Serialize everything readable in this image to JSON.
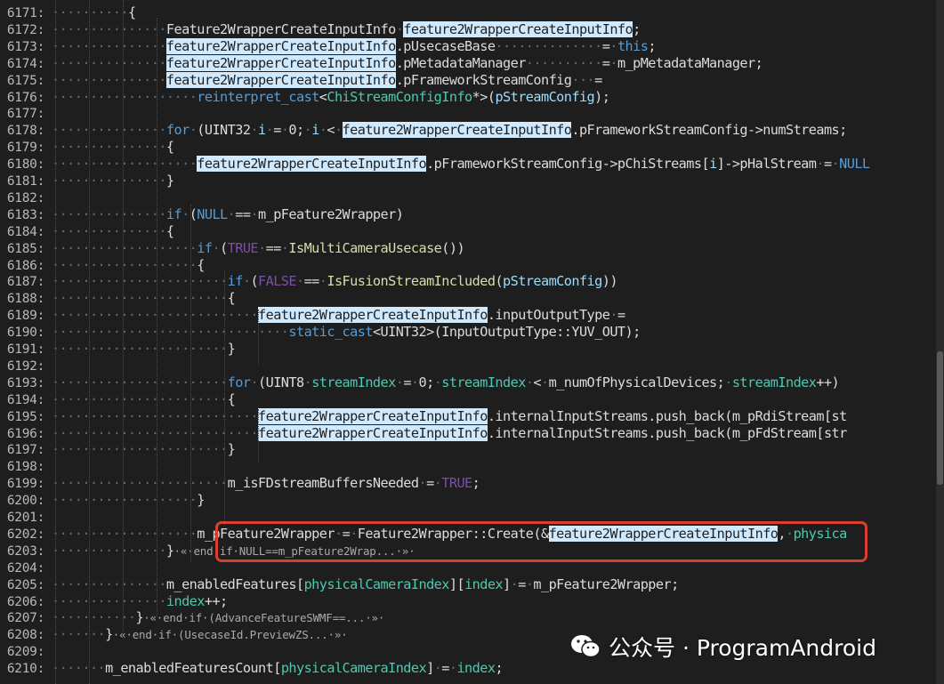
{
  "editor": {
    "lines": [
      {
        "n": "6171:",
        "t": [
          [
            "ws",
            "··········"
          ],
          [
            "p",
            "{"
          ]
        ]
      },
      {
        "n": "6172:",
        "t": [
          [
            "ws",
            "···············"
          ],
          [
            "p",
            "Feature2WrapperCreateInputInfo"
          ],
          [
            "ws",
            "·"
          ],
          [
            "hl",
            "feature2WrapperCreateInputInfo"
          ],
          [
            "p",
            ";"
          ]
        ]
      },
      {
        "n": "6173:",
        "t": [
          [
            "ws",
            "···············"
          ],
          [
            "hl",
            "feature2WrapperCreateInputInfo"
          ],
          [
            "p",
            ".pUsecaseBase"
          ],
          [
            "ws",
            "··············"
          ],
          [
            "p",
            "="
          ],
          [
            "ws",
            "·"
          ],
          [
            "kw",
            "this"
          ],
          [
            "p",
            ";"
          ]
        ]
      },
      {
        "n": "6174:",
        "t": [
          [
            "ws",
            "···············"
          ],
          [
            "hl",
            "feature2WrapperCreateInputInfo"
          ],
          [
            "p",
            ".pMetadataManager"
          ],
          [
            "ws",
            "··········"
          ],
          [
            "p",
            "="
          ],
          [
            "ws",
            "·"
          ],
          [
            "p",
            "m_pMetadataManager;"
          ]
        ]
      },
      {
        "n": "6175:",
        "t": [
          [
            "ws",
            "···············"
          ],
          [
            "hl",
            "feature2WrapperCreateInputInfo"
          ],
          [
            "p",
            ".pFrameworkStreamConfig"
          ],
          [
            "ws",
            "···"
          ],
          [
            "p",
            "="
          ]
        ]
      },
      {
        "n": "6176:",
        "t": [
          [
            "ws",
            "···················"
          ],
          [
            "kw",
            "reinterpret_cast"
          ],
          [
            "p",
            "<"
          ],
          [
            "ty",
            "ChiStreamConfigInfo"
          ],
          [
            "p",
            "*>("
          ],
          [
            "pa",
            "pStreamConfig"
          ],
          [
            "p",
            ");"
          ]
        ]
      },
      {
        "n": "6177:",
        "t": []
      },
      {
        "n": "6178:",
        "t": [
          [
            "ws",
            "···············"
          ],
          [
            "kw",
            "for"
          ],
          [
            "ws",
            "·"
          ],
          [
            "p",
            "(UINT32"
          ],
          [
            "ws",
            "·"
          ],
          [
            "pa",
            "i"
          ],
          [
            "ws",
            "·"
          ],
          [
            "p",
            "="
          ],
          [
            "ws",
            "·"
          ],
          [
            "p",
            "0;"
          ],
          [
            "ws",
            "·"
          ],
          [
            "pa",
            "i"
          ],
          [
            "ws",
            "·"
          ],
          [
            "p",
            "<"
          ],
          [
            "ws",
            "·"
          ],
          [
            "hl",
            "feature2WrapperCreateInputInfo"
          ],
          [
            "p",
            ".pFrameworkStreamConfig->numStreams;"
          ]
        ]
      },
      {
        "n": "6179:",
        "t": [
          [
            "ws",
            "···············"
          ],
          [
            "p",
            "{"
          ]
        ]
      },
      {
        "n": "6180:",
        "t": [
          [
            "ws",
            "···················"
          ],
          [
            "hl",
            "feature2WrapperCreateInputInfo"
          ],
          [
            "p",
            ".pFrameworkStreamConfig->pChiStreams["
          ],
          [
            "pa",
            "i"
          ],
          [
            "p",
            "]->pHalStream"
          ],
          [
            "ws",
            "·"
          ],
          [
            "p",
            "="
          ],
          [
            "ws",
            "·"
          ],
          [
            "kw",
            "NULL"
          ]
        ]
      },
      {
        "n": "6181:",
        "t": [
          [
            "ws",
            "···············"
          ],
          [
            "p",
            "}"
          ]
        ]
      },
      {
        "n": "6182:",
        "t": []
      },
      {
        "n": "6183:",
        "t": [
          [
            "ws",
            "···············"
          ],
          [
            "kw",
            "if"
          ],
          [
            "ws",
            "·"
          ],
          [
            "p",
            "("
          ],
          [
            "kw",
            "NULL"
          ],
          [
            "ws",
            "·"
          ],
          [
            "p",
            "=="
          ],
          [
            "ws",
            "·"
          ],
          [
            "p",
            "m_pFeature2Wrapper)"
          ]
        ]
      },
      {
        "n": "6184:",
        "t": [
          [
            "ws",
            "···············"
          ],
          [
            "p",
            "{"
          ]
        ]
      },
      {
        "n": "6185:",
        "t": [
          [
            "ws",
            "···················"
          ],
          [
            "kw",
            "if"
          ],
          [
            "ws",
            "·"
          ],
          [
            "p",
            "("
          ],
          [
            "lit",
            "TRUE"
          ],
          [
            "ws",
            "·"
          ],
          [
            "p",
            "=="
          ],
          [
            "ws",
            "·"
          ],
          [
            "fn",
            "IsMultiCameraUsecase"
          ],
          [
            "p",
            "())"
          ]
        ]
      },
      {
        "n": "6186:",
        "t": [
          [
            "ws",
            "···················"
          ],
          [
            "p",
            "{"
          ]
        ]
      },
      {
        "n": "6187:",
        "t": [
          [
            "ws",
            "·······················"
          ],
          [
            "kw",
            "if"
          ],
          [
            "ws",
            "·"
          ],
          [
            "p",
            "("
          ],
          [
            "lit",
            "FALSE"
          ],
          [
            "ws",
            "·"
          ],
          [
            "p",
            "=="
          ],
          [
            "ws",
            "·"
          ],
          [
            "fn",
            "IsFusionStreamIncluded"
          ],
          [
            "p",
            "("
          ],
          [
            "pa",
            "pStreamConfig"
          ],
          [
            "p",
            "))"
          ]
        ]
      },
      {
        "n": "6188:",
        "t": [
          [
            "ws",
            "·······················"
          ],
          [
            "p",
            "{"
          ]
        ]
      },
      {
        "n": "6189:",
        "t": [
          [
            "ws",
            "···························"
          ],
          [
            "hl",
            "feature2WrapperCreateInputInfo"
          ],
          [
            "p",
            ".inputOutputType"
          ],
          [
            "ws",
            "·"
          ],
          [
            "p",
            "="
          ]
        ]
      },
      {
        "n": "6190:",
        "t": [
          [
            "ws",
            "·······························"
          ],
          [
            "kw",
            "static_cast"
          ],
          [
            "p",
            "<UINT32>(InputOutputType::YUV_OUT);"
          ]
        ]
      },
      {
        "n": "6191:",
        "t": [
          [
            "ws",
            "·······················"
          ],
          [
            "p",
            "}"
          ]
        ]
      },
      {
        "n": "6192:",
        "t": []
      },
      {
        "n": "6193:",
        "t": [
          [
            "ws",
            "·······················"
          ],
          [
            "kw",
            "for"
          ],
          [
            "ws",
            "·"
          ],
          [
            "p",
            "(UINT8"
          ],
          [
            "ws",
            "·"
          ],
          [
            "ty",
            "streamIndex"
          ],
          [
            "ws",
            "·"
          ],
          [
            "p",
            "="
          ],
          [
            "ws",
            "·"
          ],
          [
            "p",
            "0;"
          ],
          [
            "ws",
            "·"
          ],
          [
            "ty",
            "streamIndex"
          ],
          [
            "ws",
            "·"
          ],
          [
            "p",
            "<"
          ],
          [
            "ws",
            "·"
          ],
          [
            "p",
            "m_numOfPhysicalDevices;"
          ],
          [
            "ws",
            "·"
          ],
          [
            "ty",
            "streamIndex"
          ],
          [
            "p",
            "++)"
          ]
        ]
      },
      {
        "n": "6194:",
        "t": [
          [
            "ws",
            "·······················"
          ],
          [
            "p",
            "{"
          ]
        ]
      },
      {
        "n": "6195:",
        "t": [
          [
            "ws",
            "···························"
          ],
          [
            "hl",
            "feature2WrapperCreateInputInfo"
          ],
          [
            "p",
            ".internalInputStreams.push_back(m_pRdiStream[st"
          ]
        ]
      },
      {
        "n": "6196:",
        "t": [
          [
            "ws",
            "···························"
          ],
          [
            "hl",
            "feature2WrapperCreateInputInfo"
          ],
          [
            "p",
            ".internalInputStreams.push_back(m_pFdStream[str"
          ]
        ]
      },
      {
        "n": "6197:",
        "t": [
          [
            "ws",
            "·······················"
          ],
          [
            "p",
            "}"
          ]
        ]
      },
      {
        "n": "6198:",
        "t": []
      },
      {
        "n": "6199:",
        "t": [
          [
            "ws",
            "·······················"
          ],
          [
            "p",
            "m_isFDstreamBuffersNeeded"
          ],
          [
            "ws",
            "·"
          ],
          [
            "p",
            "="
          ],
          [
            "ws",
            "·"
          ],
          [
            "lit",
            "TRUE"
          ],
          [
            "p",
            ";"
          ]
        ]
      },
      {
        "n": "6200:",
        "t": [
          [
            "ws",
            "···················"
          ],
          [
            "p",
            "}"
          ]
        ]
      },
      {
        "n": "6201:",
        "t": []
      },
      {
        "n": "6202:",
        "t": [
          [
            "ws",
            "···················"
          ],
          [
            "p",
            "m_pFeature2Wrapper"
          ],
          [
            "ws",
            "·"
          ],
          [
            "p",
            "="
          ],
          [
            "ws",
            "·"
          ],
          [
            "p",
            "Feature2Wrapper::Create(&"
          ],
          [
            "hl",
            "feature2WrapperCreateInputInfo"
          ],
          [
            "p",
            ","
          ],
          [
            "ws",
            "·"
          ],
          [
            "ty",
            "physica"
          ]
        ]
      },
      {
        "n": "6203:",
        "t": [
          [
            "ws",
            "···············"
          ],
          [
            "p",
            "}"
          ],
          [
            "col",
            "·«·end·if·NULL==m_pFeature2Wrap...·»·"
          ]
        ]
      },
      {
        "n": "6204:",
        "t": []
      },
      {
        "n": "6205:",
        "t": [
          [
            "ws",
            "···············"
          ],
          [
            "p",
            "m_enabledFeatures["
          ],
          [
            "ty",
            "physicalCameraIndex"
          ],
          [
            "p",
            "]["
          ],
          [
            "ty",
            "index"
          ],
          [
            "p",
            "]"
          ],
          [
            "ws",
            "·"
          ],
          [
            "p",
            "="
          ],
          [
            "ws",
            "·"
          ],
          [
            "p",
            "m_pFeature2Wrapper;"
          ]
        ]
      },
      {
        "n": "6206:",
        "t": [
          [
            "ws",
            "···············"
          ],
          [
            "ty",
            "index"
          ],
          [
            "p",
            "++;"
          ]
        ]
      },
      {
        "n": "6207:",
        "t": [
          [
            "ws",
            "···········"
          ],
          [
            "p",
            "}"
          ],
          [
            "col",
            "·«·end·if·(AdvanceFeatureSWMF==...·»·"
          ]
        ]
      },
      {
        "n": "6208:",
        "t": [
          [
            "ws",
            "·······"
          ],
          [
            "p",
            "}"
          ],
          [
            "col",
            "·«·end·if·(UsecaseId.PreviewZS...·»·"
          ]
        ]
      },
      {
        "n": "6209:",
        "t": []
      },
      {
        "n": "6210:",
        "t": [
          [
            "ws",
            "·······"
          ],
          [
            "p",
            "m_enabledFeaturesCount["
          ],
          [
            "ty",
            "physicalCameraIndex"
          ],
          [
            "p",
            "]"
          ],
          [
            "ws",
            "·"
          ],
          [
            "p",
            "="
          ],
          [
            "ws",
            "·"
          ],
          [
            "ty",
            "index"
          ],
          [
            "p",
            ";"
          ]
        ]
      }
    ]
  },
  "watermark": {
    "text": "公众号 · ProgramAndroid",
    "icon": "wechat-icon"
  },
  "colors": {
    "background": "#1e1e1e",
    "highlight": "#cfeaff",
    "annotation_box": "#d8402e"
  }
}
